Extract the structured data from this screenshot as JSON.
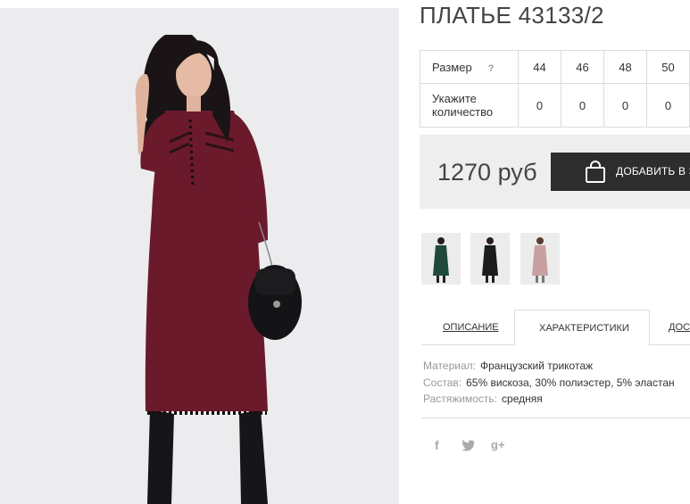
{
  "product": {
    "title": "ПЛАТЬЕ 43133/2",
    "image_alt": "Model in burgundy dress"
  },
  "size_table": {
    "row1_label": "Размер",
    "help_icon": "?",
    "sizes": [
      "44",
      "46",
      "48",
      "50"
    ],
    "row2_label_line1": "Укажите",
    "row2_label_line2": "количество",
    "quantities": [
      "0",
      "0",
      "0",
      "0"
    ]
  },
  "purchase": {
    "price": "1270 руб",
    "add_label": "Добавить в заказ",
    "bag_icon": "shopping-bag-icon"
  },
  "thumbnails": [
    {
      "name": "thumb-green",
      "color": "#1f4a3b"
    },
    {
      "name": "thumb-black",
      "color": "#1c1c1c"
    },
    {
      "name": "thumb-pink",
      "color": "#c8a0a0"
    }
  ],
  "tabs": {
    "description": "Описание",
    "characteristics": "Характеристики",
    "delivery": "Доставка"
  },
  "characteristics": [
    {
      "key": "Материал:",
      "value": "Французский трикотаж"
    },
    {
      "key": "Состав:",
      "value": "65% вискоза, 30% полиэстер, 5% эластан"
    },
    {
      "key": "Растяжимость:",
      "value": "средняя"
    }
  ],
  "social": {
    "facebook": "f",
    "twitter": "twitter-icon",
    "google": "g+"
  },
  "colors": {
    "dress": "#6b1a2c",
    "button": "#2d2d2d"
  }
}
